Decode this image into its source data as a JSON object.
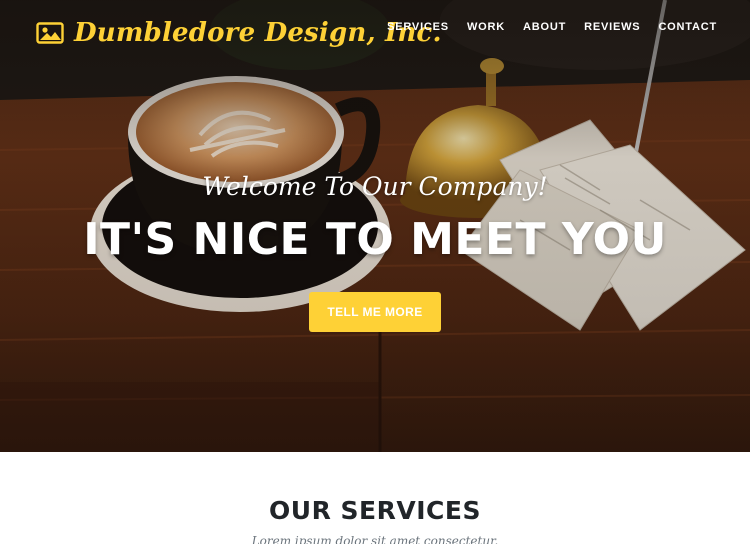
{
  "brand": {
    "name": "Dumbledore Design, Inc.",
    "icon": "image-icon",
    "color": "#fed136"
  },
  "nav": {
    "items": [
      {
        "label": "SERVICES"
      },
      {
        "label": "WORK"
      },
      {
        "label": "ABOUT"
      },
      {
        "label": "REVIEWS"
      },
      {
        "label": "CONTACT"
      }
    ]
  },
  "hero": {
    "lead": "Welcome To Our Company!",
    "heading": "IT'S NICE TO MEET YOU",
    "button_label": "TELL ME MORE",
    "button_color": "#fed136"
  },
  "services": {
    "heading": "OUR SERVICES",
    "subheading": "Lorem ipsum dolor sit amet consectetur."
  }
}
